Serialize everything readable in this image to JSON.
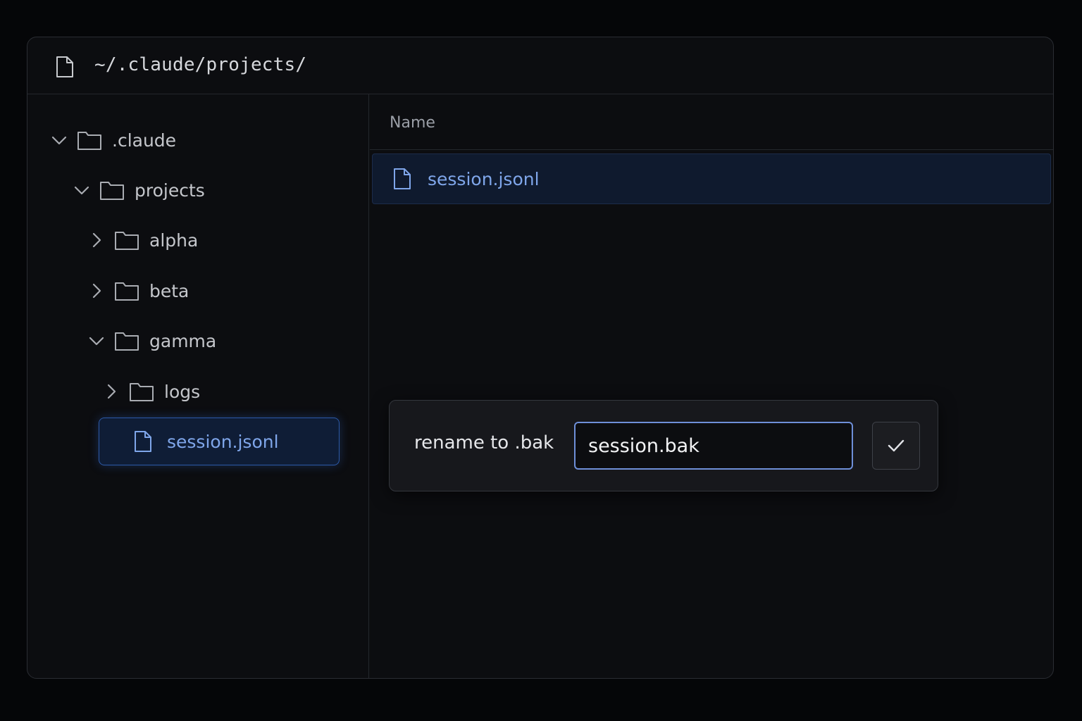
{
  "window": {
    "path": "~/.claude/projects/"
  },
  "sidebar": {
    "tree": [
      {
        "label": ".claude",
        "expanded": true,
        "icon": "folder-icon"
      },
      {
        "label": "projects",
        "expanded": true,
        "icon": "folder-icon"
      },
      {
        "label": "alpha",
        "expanded": false,
        "icon": "folder-icon"
      },
      {
        "label": "beta",
        "expanded": false,
        "icon": "folder-icon"
      },
      {
        "label": "gamma",
        "expanded": true,
        "icon": "folder-icon"
      },
      {
        "label": "logs",
        "expanded": false,
        "icon": "folder-icon"
      }
    ],
    "selected_file": {
      "label": "session.jsonl",
      "icon": "file-icon"
    }
  },
  "main": {
    "column_header": "Name",
    "files": [
      {
        "label": "session.jsonl",
        "icon": "file-icon",
        "selected": true
      }
    ]
  },
  "rename": {
    "label": "rename to .bak",
    "value": "session.bak",
    "confirm_icon": "check-icon"
  },
  "colors": {
    "background": "#050608",
    "window": "#0c0d10",
    "accent": "#7fa6ea",
    "selection": "#0f1d36",
    "input_border": "#6e8fd8"
  }
}
